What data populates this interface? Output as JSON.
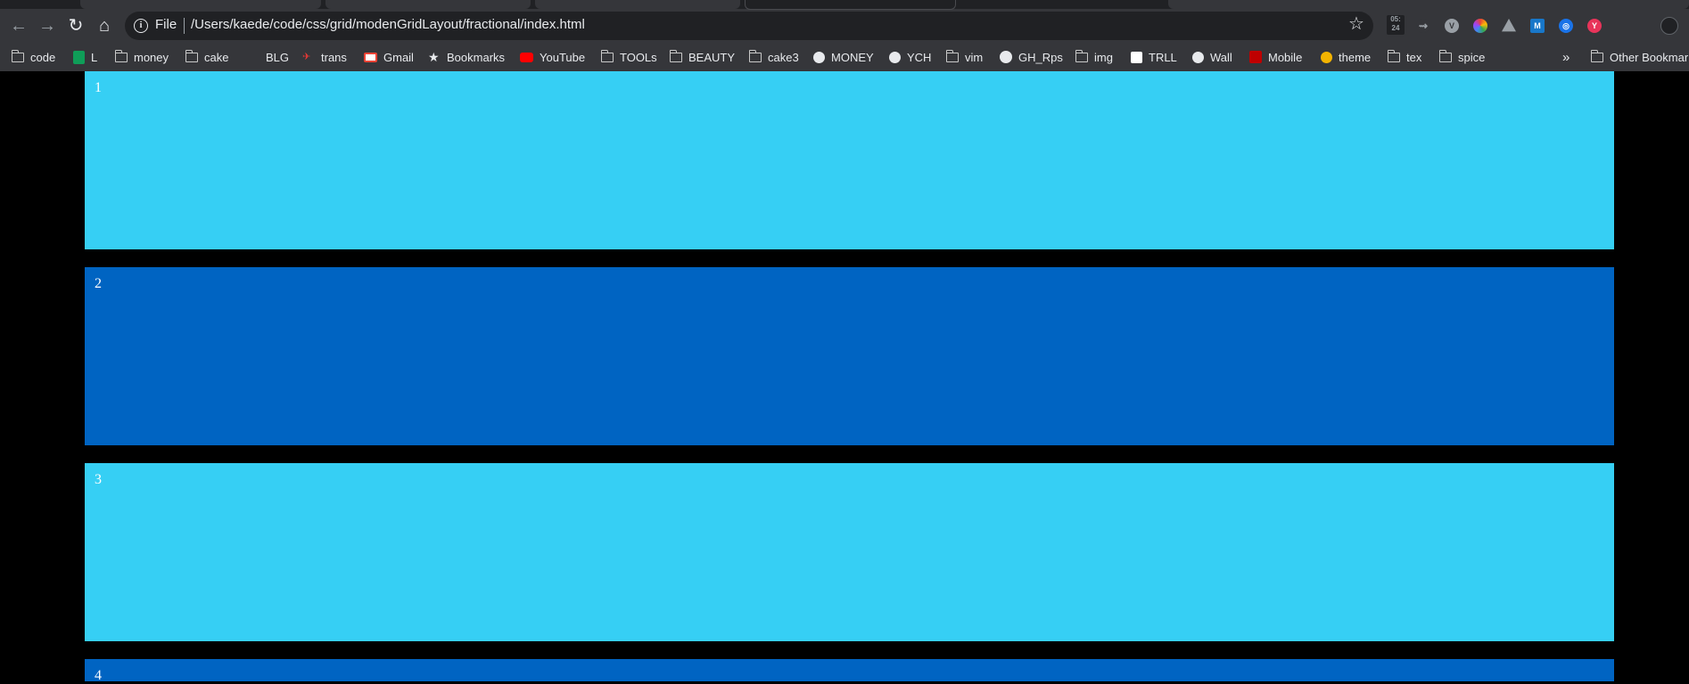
{
  "browser": {
    "scheme_label": "File",
    "url": "/Users/kaede/code/css/grid/modenGridLayout/fractional/index.html",
    "extension_badge": "05:\n24"
  },
  "bookmarks": [
    {
      "label": "code",
      "icon": "folder-icon"
    },
    {
      "label": "L",
      "icon": "sheets-icon"
    },
    {
      "label": "money",
      "icon": "folder-icon"
    },
    {
      "label": "cake",
      "icon": "folder-icon"
    },
    {
      "label": "BLG",
      "icon": "blank-icon"
    },
    {
      "label": "trans",
      "icon": "trans-icon"
    },
    {
      "label": "Gmail",
      "icon": "gmail-icon"
    },
    {
      "label": "Bookmarks",
      "icon": "star-icon"
    },
    {
      "label": "YouTube",
      "icon": "youtube-icon"
    },
    {
      "label": "TOOLs",
      "icon": "folder-icon"
    },
    {
      "label": "BEAUTY",
      "icon": "folder-icon"
    },
    {
      "label": "cake3",
      "icon": "folder-icon"
    },
    {
      "label": "MONEY",
      "icon": "globe-icon"
    },
    {
      "label": "YCH",
      "icon": "globe-icon"
    },
    {
      "label": "vim",
      "icon": "folder-icon"
    },
    {
      "label": "GH_Rps",
      "icon": "github-icon"
    },
    {
      "label": "img",
      "icon": "folder-icon"
    },
    {
      "label": "TRLL",
      "icon": "trello-icon"
    },
    {
      "label": "Wall",
      "icon": "globe-icon"
    },
    {
      "label": "Mobile",
      "icon": "rakuten-icon"
    },
    {
      "label": "theme",
      "icon": "palette-icon"
    },
    {
      "label": "tex",
      "icon": "folder-icon"
    },
    {
      "label": "spice",
      "icon": "folder-icon"
    }
  ],
  "other_bookmarks": "Other Bookmarks",
  "page": {
    "items": [
      "1",
      "2",
      "3",
      "4"
    ],
    "colors": {
      "light": "#36cff4",
      "dark": "#0064c2",
      "background": "#000000"
    }
  }
}
